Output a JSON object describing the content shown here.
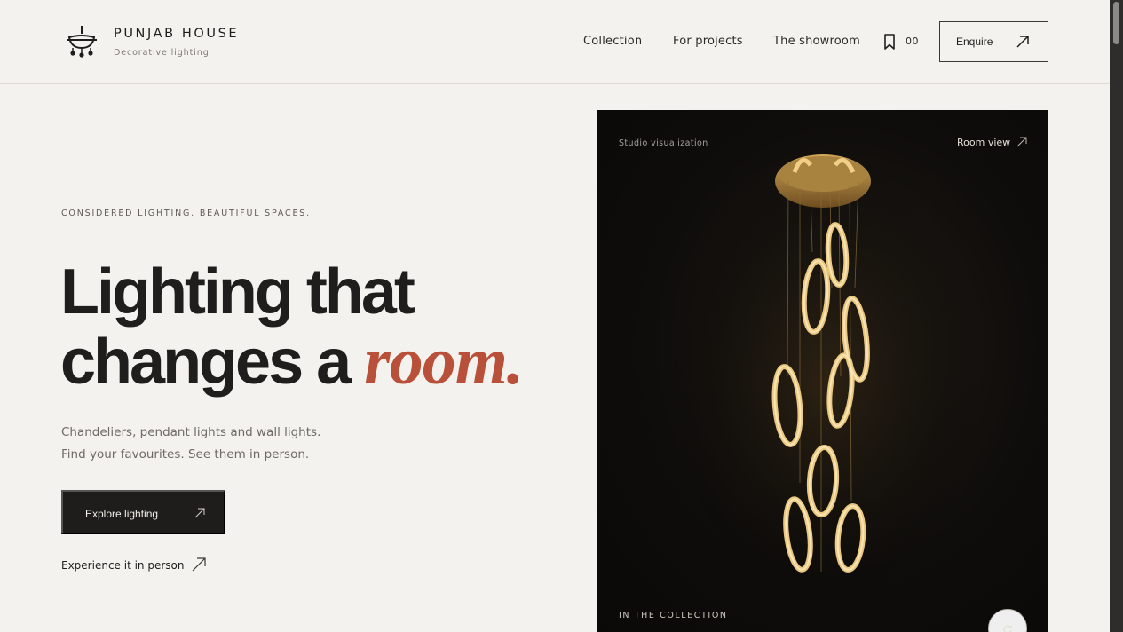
{
  "header": {
    "brand_name": "PUNJAB HOUSE",
    "brand_tagline": "Decorative lighting",
    "logo_icon": "chandelier-icon",
    "nav": [
      {
        "label": "Collection"
      },
      {
        "label": "For projects"
      },
      {
        "label": "The showroom"
      }
    ],
    "bookmark_icon": "bookmark-icon",
    "bookmark_count": "00",
    "enquire_label": "Enquire"
  },
  "hero": {
    "eyebrow": "CONSIDERED LIGHTING. BEAUTIFUL SPACES.",
    "headline_line1": "Lighting that",
    "headline_line2": "changes a ",
    "headline_accent": "room.",
    "sub_line1": "Chandeliers, pendant lights and wall lights.",
    "sub_line2": "Find your favourites. See them in person.",
    "primary_cta": "Explore lighting",
    "secondary_cta": "Experience it in person"
  },
  "panel": {
    "caption": "Studio visualization",
    "room_view_label": "Room view",
    "collection_label": "IN THE COLLECTION",
    "rotate_icon": "rotate-icon"
  },
  "colors": {
    "background": "#f4f2ee",
    "text": "#1f1e1c",
    "accent": "#b9513a",
    "button_dark": "#1e1d1b",
    "panel_bg": "#0f0d0b",
    "brass": "#c9a35b"
  }
}
